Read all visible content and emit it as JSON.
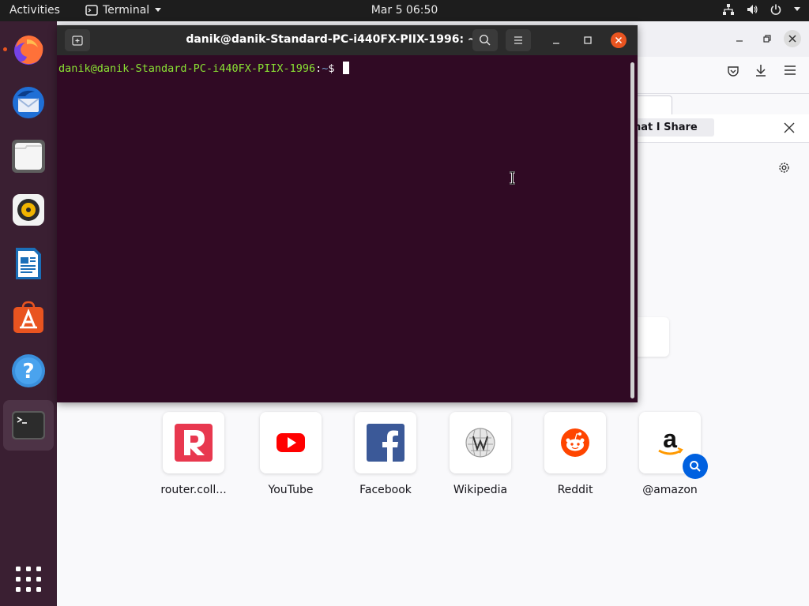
{
  "topbar": {
    "activities": "Activities",
    "app_menu": "Terminal",
    "clock": "Mar 5  06:50"
  },
  "dock": {
    "items": [
      {
        "name": "Firefox Web Browser",
        "icon": "firefox-icon",
        "running": true
      },
      {
        "name": "Thunderbird Mail",
        "icon": "thunderbird-icon"
      },
      {
        "name": "Files",
        "icon": "files-icon"
      },
      {
        "name": "Rhythmbox",
        "icon": "rhythmbox-icon"
      },
      {
        "name": "LibreOffice Writer",
        "icon": "writer-icon"
      },
      {
        "name": "Ubuntu Software",
        "icon": "software-icon"
      },
      {
        "name": "Help",
        "icon": "help-icon"
      },
      {
        "name": "Terminal",
        "icon": "terminal-icon",
        "running": true,
        "active": true
      },
      {
        "name": "Show Applications",
        "icon": "app-grid-icon"
      }
    ]
  },
  "terminal": {
    "title": "danik@danik-Standard-PC-i440FX-PIIX-1996: ~",
    "prompt_user_host": "danik@danik-Standard-PC-i440FX-PIIX-1996",
    "prompt_sep": ":",
    "prompt_path": "~",
    "prompt_symbol": "$"
  },
  "firefox": {
    "notice_button": "hat I Share",
    "shortcuts": [
      {
        "label": "router.coll...",
        "icon": "router-icon"
      },
      {
        "label": "YouTube",
        "icon": "youtube-icon"
      },
      {
        "label": "Facebook",
        "icon": "facebook-icon"
      },
      {
        "label": "Wikipedia",
        "icon": "wikipedia-icon"
      },
      {
        "label": "Reddit",
        "icon": "reddit-icon"
      },
      {
        "label": "@amazon",
        "icon": "amazon-icon"
      }
    ]
  },
  "colors": {
    "terminal_bg": "#300a24",
    "dock_bg": "#3a1f32",
    "accent": "#e95420",
    "prompt_user": "#8ae234",
    "prompt_path": "#729fcf"
  }
}
